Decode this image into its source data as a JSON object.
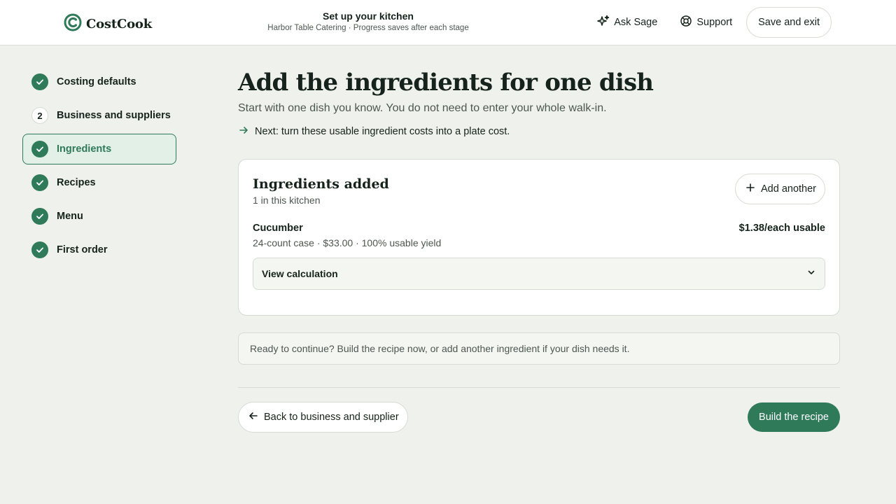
{
  "header": {
    "brand": "CostCook",
    "title": "Set up your kitchen",
    "subtitle": "Harbor Table Catering · Progress saves after each stage",
    "ask_label": "Ask Sage",
    "support_label": "Support",
    "save_exit_label": "Save and exit"
  },
  "sidebar": {
    "items": [
      {
        "label": "Costing defaults",
        "state": "done"
      },
      {
        "label": "Business and suppliers",
        "state": "numbered",
        "number": "2"
      },
      {
        "label": "Ingredients",
        "state": "active"
      },
      {
        "label": "Recipes",
        "state": "done"
      },
      {
        "label": "Menu",
        "state": "done"
      },
      {
        "label": "First order",
        "state": "done"
      }
    ]
  },
  "main": {
    "title": "Add the ingredients for one dish",
    "subtitle": "Start with one dish you know. You do not need to enter your whole walk-in.",
    "next_text": "Next: turn these usable ingredient costs into a plate cost.",
    "card": {
      "title": "Ingredients added",
      "count_text": "1 in this kitchen",
      "add_label": "Add another",
      "ingredients": [
        {
          "name": "Cucumber",
          "details": "24-count case · $33.00 · 100% usable yield",
          "cost": "$1.38/each usable"
        }
      ],
      "calc_label": "View calculation"
    },
    "notice": "Ready to continue? Build the recipe now, or add another ingredient if your dish needs it.",
    "back_label": "Back to business and supplier",
    "primary_label": "Build the recipe"
  },
  "colors": {
    "accent": "#2f7a58",
    "background": "#eff1ec",
    "text": "#16231c",
    "muted": "#4d5751"
  }
}
